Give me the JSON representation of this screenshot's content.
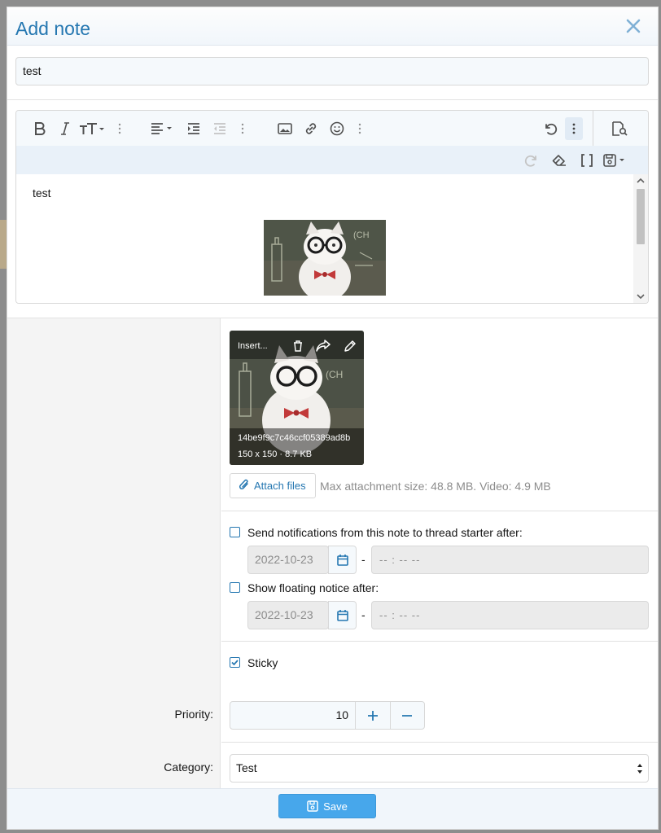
{
  "modal": {
    "title": "Add note",
    "close_icon": "close-icon"
  },
  "title_input": {
    "value": "test"
  },
  "editor": {
    "toolbar_icons": [
      "bold-icon",
      "italic-icon",
      "text-size-icon",
      "more-vertical-icon",
      "align-left-icon",
      "indent-icon",
      "outdent-icon",
      "more-vertical-icon",
      "image-icon",
      "link-icon",
      "smiley-icon",
      "more-vertical-icon",
      "undo-icon",
      "more-vertical-icon",
      "preview-icon",
      "redo-icon",
      "eraser-icon",
      "bbcode-icon",
      "save-draft-icon"
    ],
    "body_text": "test"
  },
  "attachment": {
    "insert_label": "Insert...",
    "filename": "14be9f9c7c46ccf05389ad8b",
    "meta": "150 x 150 · 8.7 KB"
  },
  "attach": {
    "button_label": "Attach files",
    "info": "Max attachment size: 48.8 MB. Video: 4.9 MB"
  },
  "notifications": {
    "label": "Send notifications from this note to thread starter after:",
    "date": "2022-10-23",
    "time": "-- : --   --",
    "checked": false
  },
  "floating": {
    "label": "Show floating notice after:",
    "date": "2022-10-23",
    "time": "-- : --   --",
    "checked": false
  },
  "sticky": {
    "label": "Sticky",
    "checked": true
  },
  "priority": {
    "label": "Priority:",
    "value": "10"
  },
  "category": {
    "label": "Category:",
    "value": "Test"
  },
  "footer": {
    "save_label": "Save"
  },
  "colors": {
    "accent": "#2577b1",
    "save_bg": "#47a7eb"
  }
}
